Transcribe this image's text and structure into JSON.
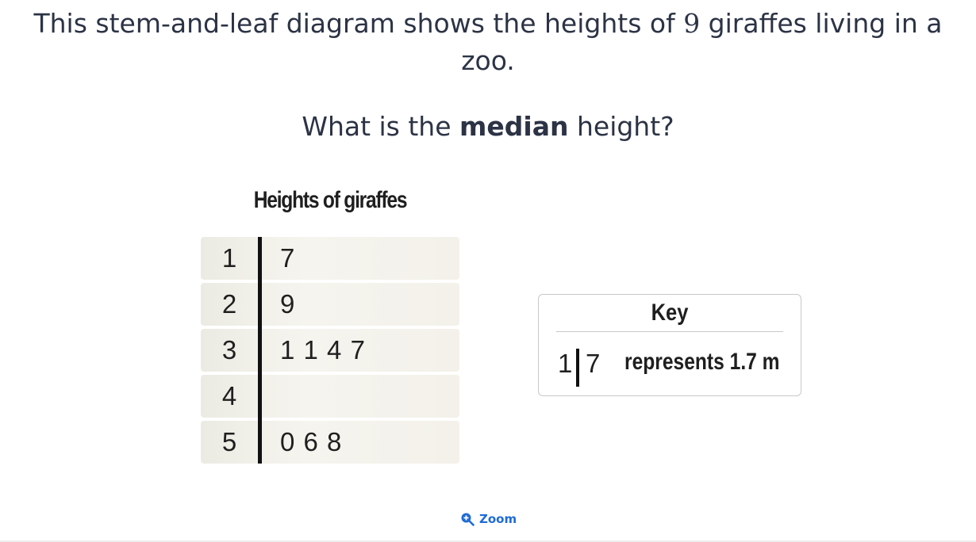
{
  "question": {
    "text_before": "This stem-and-leaf diagram shows the heights of ",
    "number": "9",
    "text_after": " giraffes living in a zoo."
  },
  "prompt": {
    "before": "What is the ",
    "bold": "median",
    "after": " height?"
  },
  "figure": {
    "title": "Heights of giraffes",
    "rows": [
      {
        "stem": "1",
        "leaves": "7"
      },
      {
        "stem": "2",
        "leaves": "9"
      },
      {
        "stem": "3",
        "leaves": "1 1 4 7"
      },
      {
        "stem": "4",
        "leaves": ""
      },
      {
        "stem": "5",
        "leaves": "0 6 8"
      }
    ]
  },
  "key": {
    "title": "Key",
    "stem": "1",
    "leaf": "7",
    "text": "represents 1.7 m"
  },
  "zoom": {
    "label": "Zoom",
    "icon": "zoom-in-icon",
    "color": "#1f6bd6"
  }
}
